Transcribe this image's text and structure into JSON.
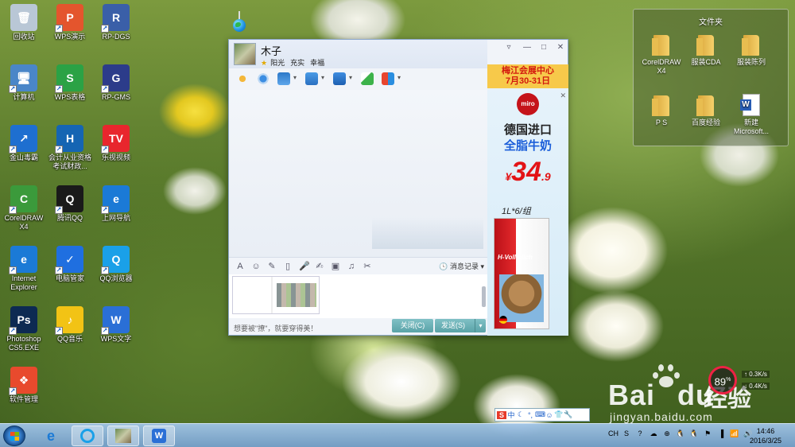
{
  "desktop": {
    "icons": [
      {
        "label": "回收站",
        "icon": "recycle-bin-icon",
        "color": "#b9c7d6"
      },
      {
        "label": "WPS演示",
        "icon": "wps-presentation-icon",
        "color": "#e4552d"
      },
      {
        "label": "RP-DGS",
        "icon": "rp-dgs-icon",
        "color": "#3a5fa8"
      },
      {
        "label": "计算机",
        "icon": "computer-icon",
        "color": "#4a86c8"
      },
      {
        "label": "WPS表格",
        "icon": "wps-spreadsheet-icon",
        "color": "#2ba245"
      },
      {
        "label": "RP-GMS",
        "icon": "rp-gms-icon",
        "color": "#2c3c8a"
      },
      {
        "label": "金山毒霸",
        "icon": "kingsoft-antivirus-icon",
        "color": "#1e6fd0"
      },
      {
        "label": "会计从业资格考试财政...",
        "icon": "accounting-exam-icon",
        "color": "#1565b3"
      },
      {
        "label": "乐视视频",
        "icon": "letv-video-icon",
        "color": "#e8262d"
      },
      {
        "label": "CorelDRAW X4",
        "icon": "coreldraw-icon",
        "color": "#3b9a3b"
      },
      {
        "label": "腾讯QQ",
        "icon": "tencent-qq-icon",
        "color": "#1a1a1a"
      },
      {
        "label": "上网导航",
        "icon": "web-navigation-icon",
        "color": "#1b7ad6"
      },
      {
        "label": "Internet Explorer",
        "icon": "internet-explorer-icon",
        "color": "#1b7ad6"
      },
      {
        "label": "电脑管家",
        "icon": "pc-manager-icon",
        "color": "#1f6fe0"
      },
      {
        "label": "QQ浏览器",
        "icon": "qq-browser-icon",
        "color": "#1aa0e8"
      },
      {
        "label": "Photoshop CS5.EXE",
        "icon": "photoshop-icon",
        "color": "#0d2a52"
      },
      {
        "label": "QQ音乐",
        "icon": "qq-music-icon",
        "color": "#f2c315"
      },
      {
        "label": "WPS文字",
        "icon": "wps-writer-icon",
        "color": "#2a6fd6"
      },
      {
        "label": "软件管理",
        "icon": "software-manager-icon",
        "color": "#e84a2d"
      }
    ],
    "icon_glyphs": [
      "🗑",
      "P",
      "R",
      "🖥",
      "S",
      "G",
      "↗",
      "H",
      "TV",
      "C",
      "Q",
      "e",
      "e",
      "✓",
      "Q",
      "Ps",
      "♪",
      "W",
      "❖"
    ]
  },
  "folder_panel": {
    "title": "文件夹",
    "items": [
      {
        "label": "CorelDRAW X4",
        "type": "folder"
      },
      {
        "label": "服装CDA",
        "type": "folder"
      },
      {
        "label": "服装陈列",
        "type": "folder"
      },
      {
        "label": "P S",
        "type": "folder"
      },
      {
        "label": "百度经验",
        "type": "folder"
      },
      {
        "label": "新建 Microsoft...",
        "type": "word-doc"
      }
    ]
  },
  "chat": {
    "contact_name": "木子",
    "status_words": [
      "阳光",
      "充实",
      "幸福"
    ],
    "window_controls": [
      "▿",
      "—",
      "□",
      "✕"
    ],
    "message_record_label": "消息记录",
    "footer_tip": "想要被\"撩\"，就要穿得美！",
    "close_label": "关闭(C)",
    "send_label": "发送(S)",
    "send_arrow": "▾"
  },
  "ad": {
    "banner_line1": "梅江会展中心",
    "banner_line2": "7月30-31日",
    "logo_text": "miro",
    "line1": "德国进口",
    "line2": "全脂牛奶",
    "price_symbol": "¥",
    "price": "34",
    "price_decimal": ".9",
    "unit": "1L*6/组",
    "carton_brand": "H-Vollmilch",
    "close": "✕"
  },
  "watermark": {
    "logo": "Bai",
    "logo2": "du",
    "jingyan": "经验",
    "url": "jingyan.baidu.com"
  },
  "speed_widget": {
    "percent": "89",
    "percent_unit": "%",
    "up": "0.3K/s",
    "down": "0.4K/s"
  },
  "ime_bar": {
    "items": [
      "S",
      "中",
      "☾",
      "°,",
      "⌨",
      "☺",
      "👕",
      "🔧"
    ]
  },
  "taskbar": {
    "tray_items": [
      "CH",
      "S",
      "?",
      "☁",
      "⊕",
      "🐧",
      "🐧",
      "⚑",
      "▐",
      "📶",
      "🔊"
    ],
    "time": "14:46",
    "date": "2016/3/25"
  },
  "colors": {
    "send_button": "#5aa3a8",
    "ad_banner": "#f7c94a",
    "price_red": "#e31316",
    "promo_blue": "#1b5ed9"
  }
}
